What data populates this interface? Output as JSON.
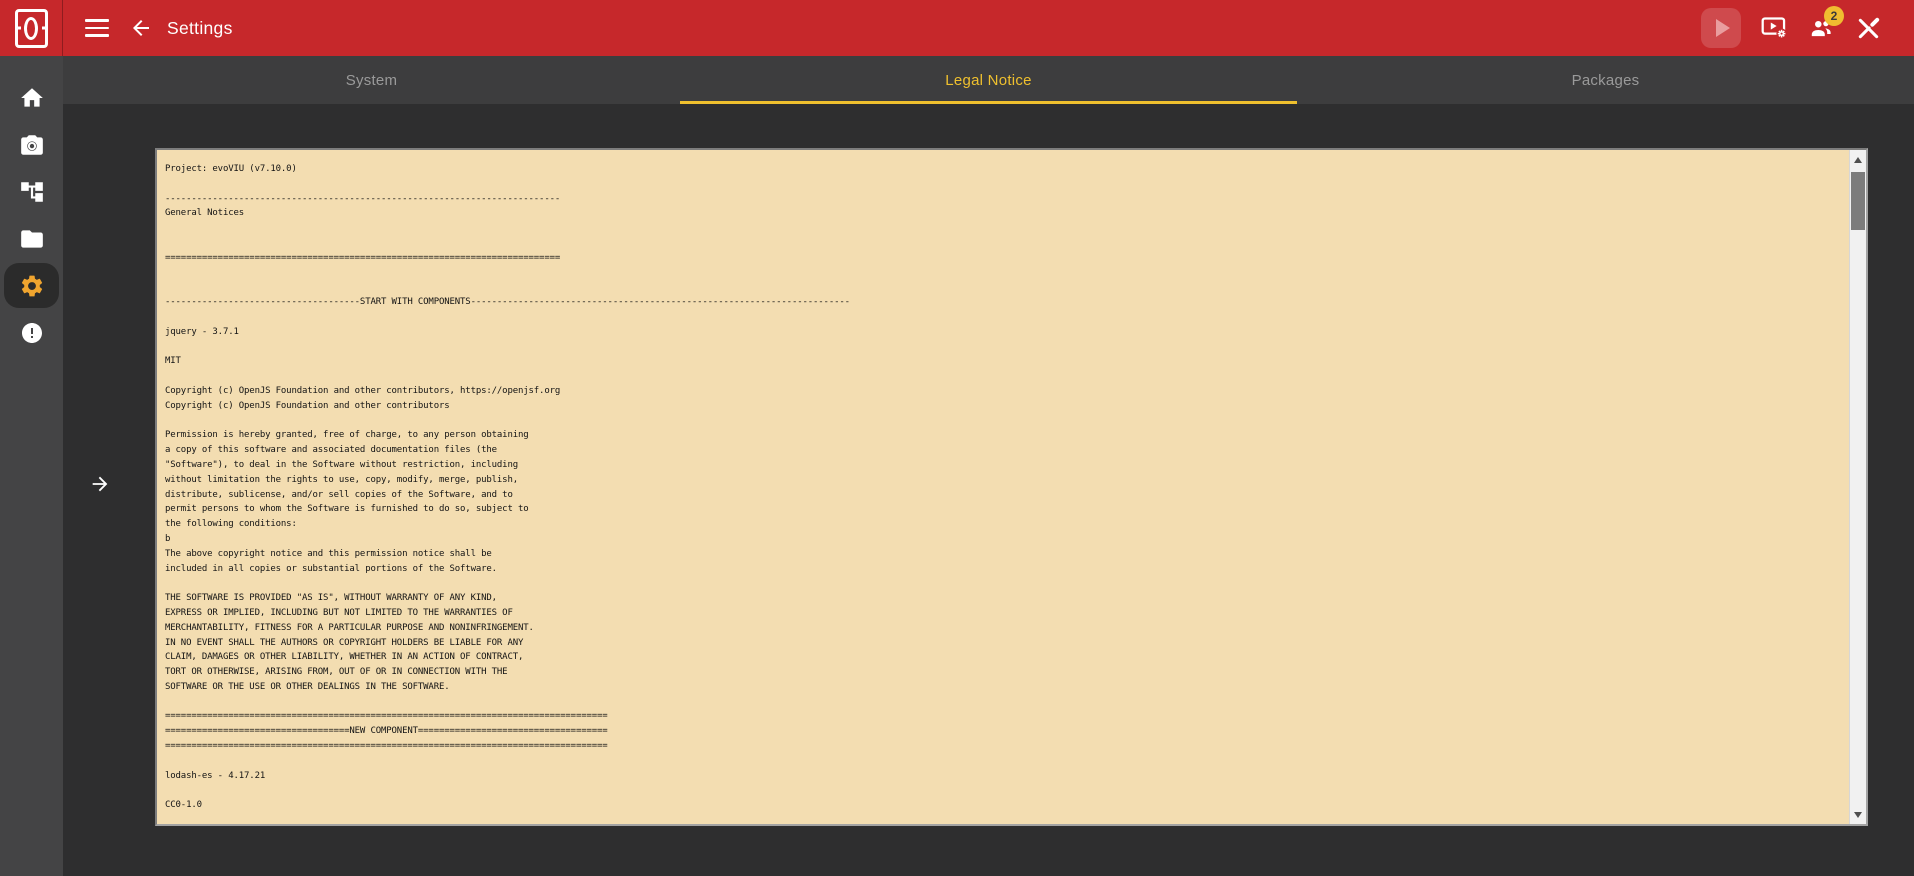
{
  "app_bar": {
    "title": "Settings",
    "connected_badge": "2"
  },
  "logo": {
    "name": "evoVIU-brand-mark"
  },
  "icons": {
    "app_bar_left": [
      "menu-icon",
      "back-arrow-icon"
    ],
    "app_bar_right": [
      "play-icon",
      "stream-settings-icon",
      "connected-users-icon",
      "close-icon"
    ],
    "sidebar": [
      "home-icon",
      "camera-icon",
      "process-tree-icon",
      "folder-icon",
      "settings-gear-icon",
      "alert-icon"
    ],
    "content": [
      "expand-drawer-arrow-icon",
      "scroll-up-icon",
      "scroll-down-icon"
    ]
  },
  "sidebar": {
    "items": [
      {
        "name": "home",
        "active": false
      },
      {
        "name": "camera",
        "active": false
      },
      {
        "name": "process-tree",
        "active": false
      },
      {
        "name": "files",
        "active": false
      },
      {
        "name": "settings",
        "active": true
      },
      {
        "name": "alerts",
        "active": false
      }
    ]
  },
  "tabs": [
    {
      "label": "System",
      "active": false
    },
    {
      "label": "Legal Notice",
      "active": true
    },
    {
      "label": "Packages",
      "active": false
    }
  ],
  "colors": {
    "app_bar_red": "#C6282B",
    "accent_yellow": "#EFC02E",
    "gear_orange": "#F0A52F",
    "badge_amber": "#F0BD30",
    "sidebar_gray": "#444445",
    "tabbar_gray": "#3D3D3E",
    "content_gray": "#2E2E2F",
    "textarea_beige": "#F3DDB1"
  },
  "license": {
    "project": "evoVIU",
    "version": "v7.10.0",
    "text": "Project: evoVIU (v7.10.0)\n\n---------------------------------------------------------------------------\nGeneral Notices\n\n\n===========================================================================\n\n\n-------------------------------------START WITH COMPONENTS------------------------------------------------------------------------\n\njquery - 3.7.1\n\nMIT\n\nCopyright (c) OpenJS Foundation and other contributors, https://openjsf.org\nCopyright (c) OpenJS Foundation and other contributors\n\nPermission is hereby granted, free of charge, to any person obtaining\na copy of this software and associated documentation files (the\n\"Software\"), to deal in the Software without restriction, including\nwithout limitation the rights to use, copy, modify, merge, publish,\ndistribute, sublicense, and/or sell copies of the Software, and to\npermit persons to whom the Software is furnished to do so, subject to\nthe following conditions:\nb\nThe above copyright notice and this permission notice shall be\nincluded in all copies or substantial portions of the Software.\n\nTHE SOFTWARE IS PROVIDED \"AS IS\", WITHOUT WARRANTY OF ANY KIND,\nEXPRESS OR IMPLIED, INCLUDING BUT NOT LIMITED TO THE WARRANTIES OF\nMERCHANTABILITY, FITNESS FOR A PARTICULAR PURPOSE AND NONINFRINGEMENT.\nIN NO EVENT SHALL THE AUTHORS OR COPYRIGHT HOLDERS BE LIABLE FOR ANY\nCLAIM, DAMAGES OR OTHER LIABILITY, WHETHER IN AN ACTION OF CONTRACT,\nTORT OR OTHERWISE, ARISING FROM, OUT OF OR IN CONNECTION WITH THE\nSOFTWARE OR THE USE OR OTHER DEALINGS IN THE SOFTWARE.\n\n====================================================================================\n===================================NEW COMPONENT====================================\n====================================================================================\n\nlodash-es - 4.17.21\n\nCC0-1.0"
  }
}
